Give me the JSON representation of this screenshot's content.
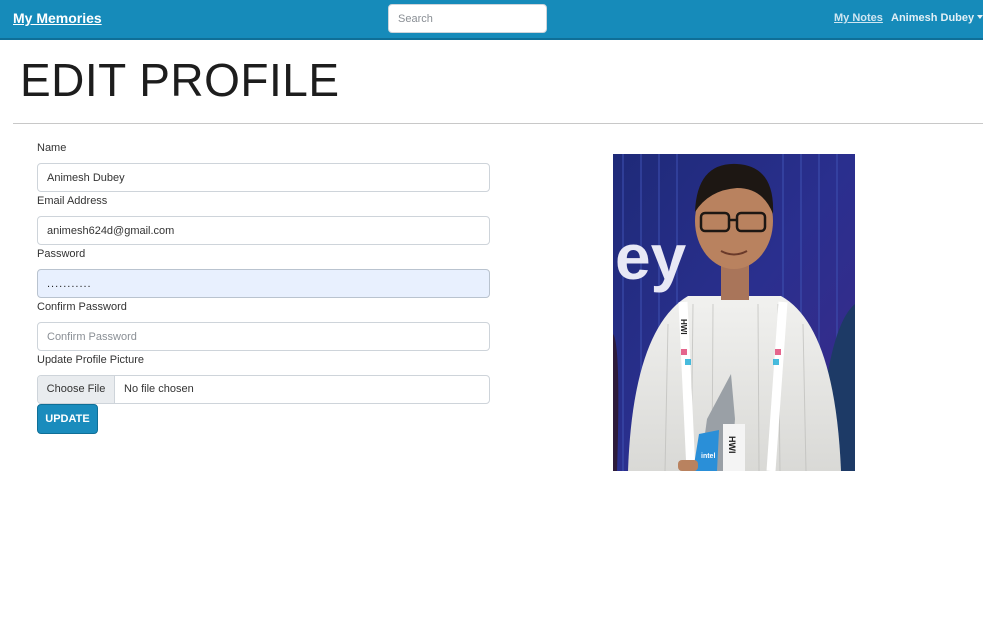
{
  "navbar": {
    "brand": "My Memories",
    "search_placeholder": "Search",
    "notes_link": "My Notes",
    "user_name": "Animesh Dubey"
  },
  "page": {
    "title": "EDIT PROFILE"
  },
  "form": {
    "name_label": "Name",
    "name_value": "Animesh Dubey",
    "email_label": "Email Address",
    "email_value": "animesh624d@gmail.com",
    "password_label": "Password",
    "password_value": "...........",
    "confirm_label": "Confirm Password",
    "confirm_placeholder": "Confirm Password",
    "picture_label": "Update Profile Picture",
    "file_button": "Choose File",
    "file_status": "No file chosen",
    "update_button": "UPDATE"
  },
  "colors": {
    "navbar": "#168bba",
    "button": "#1a8cbd",
    "autofill": "#e8f0fe"
  },
  "profile_picture": {
    "icon": "profile-photo",
    "board_text_left": "ey",
    "lanyard_text": "HWI",
    "trophy_text": "HWI",
    "trophy_brand": "intel"
  }
}
